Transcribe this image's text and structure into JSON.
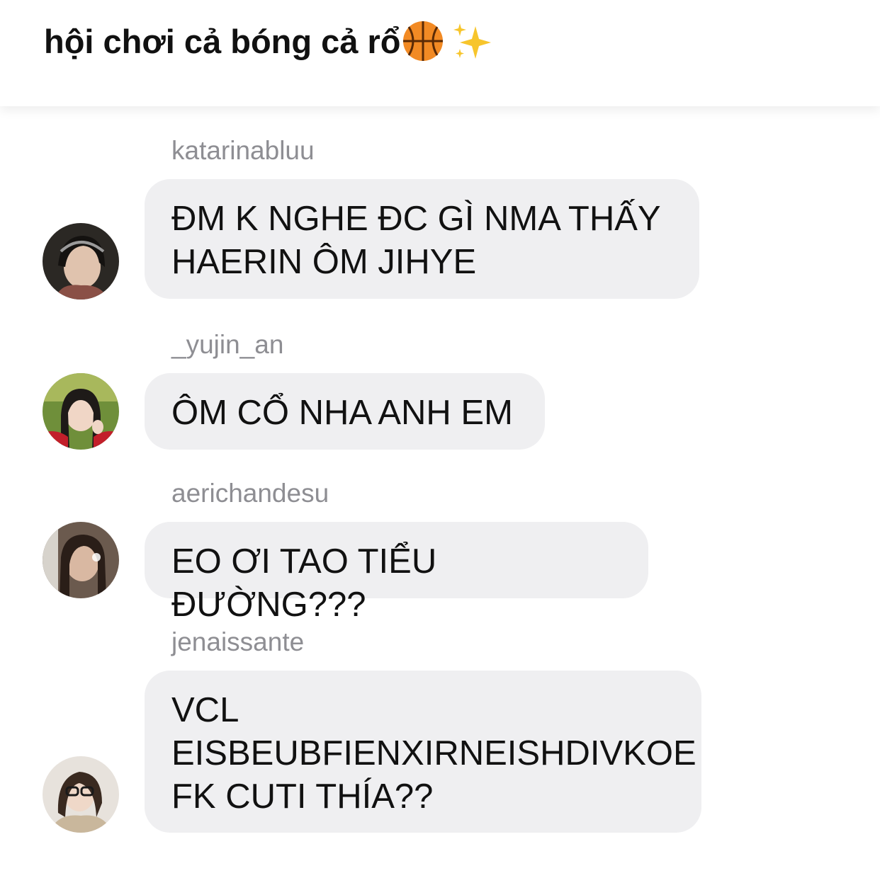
{
  "header": {
    "title": "hội chơi cả bóng cả rổ",
    "icons": [
      "basketball-icon",
      "sparkles-icon"
    ]
  },
  "messages": [
    {
      "username": "katarinabluu",
      "text": "ĐM K NGHE ĐC GÌ NMA THẤY\nHAERIN ÔM JIHYE"
    },
    {
      "username": "_yujin_an",
      "text": "ÔM CỔ NHA ANH EM"
    },
    {
      "username": "aerichandesu",
      "text": "EO ƠI TAO TIỂU ĐƯỜNG???"
    },
    {
      "username": "jenaissante",
      "text": "VCL\nEISBEUBFIENXIRNEISHDIVKOE\nFK CUTI THÍA??"
    }
  ],
  "colors": {
    "bubble": "#efeff1",
    "username": "#8e8e93",
    "text": "#111111"
  }
}
